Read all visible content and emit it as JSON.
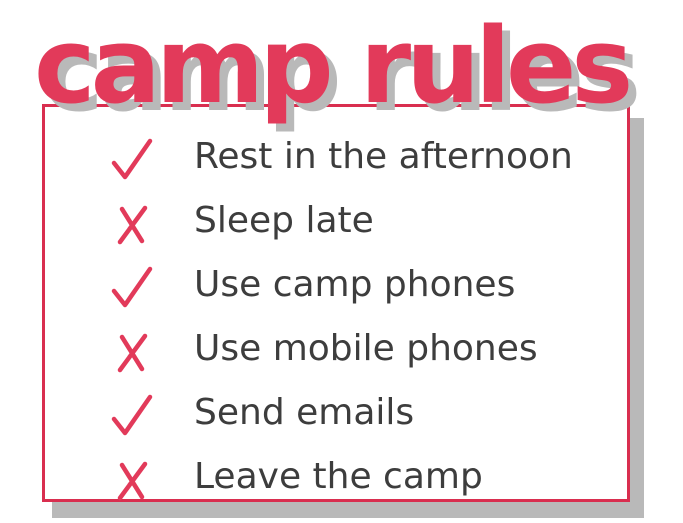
{
  "title": "camp rules",
  "colors": {
    "accent": "#e23a5a",
    "border": "#d92e4f",
    "shadow": "#b9b9b9",
    "text": "#3d3d3d"
  },
  "rules": [
    {
      "text": "Rest in the afternoon",
      "allowed": true,
      "icon": "check-icon"
    },
    {
      "text": "Sleep late",
      "allowed": false,
      "icon": "cross-icon"
    },
    {
      "text": "Use camp phones",
      "allowed": true,
      "icon": "check-icon"
    },
    {
      "text": "Use mobile phones",
      "allowed": false,
      "icon": "cross-icon"
    },
    {
      "text": "Send emails",
      "allowed": true,
      "icon": "check-icon"
    },
    {
      "text": "Leave the camp",
      "allowed": false,
      "icon": "cross-icon"
    }
  ]
}
